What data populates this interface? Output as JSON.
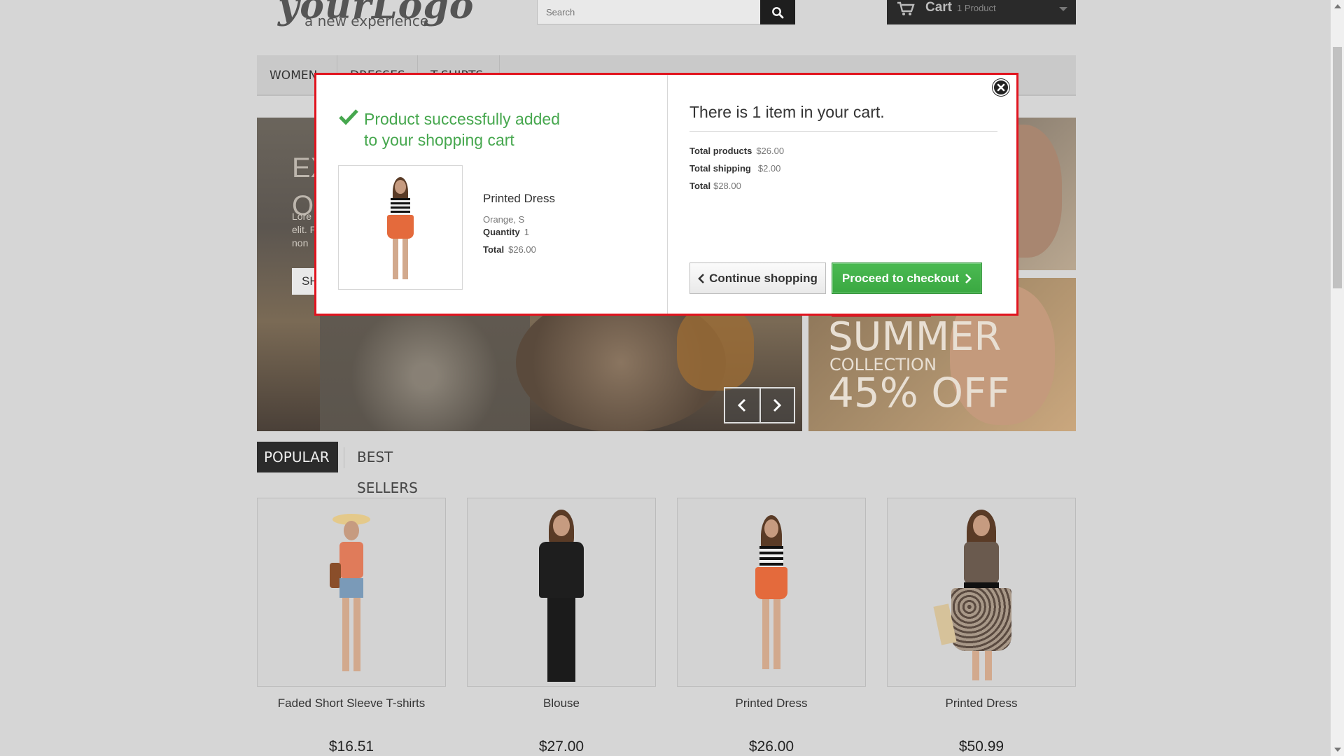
{
  "header": {
    "logo_script": "yourLogo",
    "logo_tagline": "a new experience",
    "search_placeholder": "Search",
    "cart_label": "Cart",
    "cart_count": "1 Product"
  },
  "nav": {
    "items": [
      {
        "label": "WOMEN"
      },
      {
        "label": "DRESSES"
      },
      {
        "label": "T-SHIRTS"
      }
    ]
  },
  "hero": {
    "title_line1": "EX",
    "title_line2": "O",
    "text_line1": "Lore",
    "text_line2": "elit. F",
    "text_line3": "non",
    "button_label": "SH"
  },
  "promo": {
    "title": "SUMMER",
    "subtitle": "COLLECTION",
    "offer": "45% OFF"
  },
  "tabs": {
    "popular": "POPULAR",
    "best_sellers": "BEST SELLERS"
  },
  "products": [
    {
      "name": "Faded Short Sleeve T-shirts",
      "price": "$16.51"
    },
    {
      "name": "Blouse",
      "price": "$27.00"
    },
    {
      "name": "Printed Dress",
      "price": "$26.00"
    },
    {
      "name": "Printed Dress",
      "price": "$50.99"
    }
  ],
  "modal": {
    "success_line1": "Product successfully added",
    "success_line2": "to your shopping cart",
    "product_name": "Printed Dress",
    "product_attributes": "Orange, S",
    "quantity_label": "Quantity",
    "quantity_value": "1",
    "total_label": "Total",
    "total_value": "$26.00",
    "cart_heading": "There is 1 item in your cart.",
    "total_products_label": "Total products",
    "total_products_value": "$26.00",
    "total_shipping_label": "Total shipping",
    "total_shipping_value": "$2.00",
    "grand_total_label": "Total",
    "grand_total_value": "$28.00",
    "continue_label": "Continue shopping",
    "checkout_label": "Proceed to checkout"
  },
  "colors": {
    "modal_border": "#e1141f",
    "success_green": "#46a74e",
    "checkout_green": "#3aa841"
  }
}
